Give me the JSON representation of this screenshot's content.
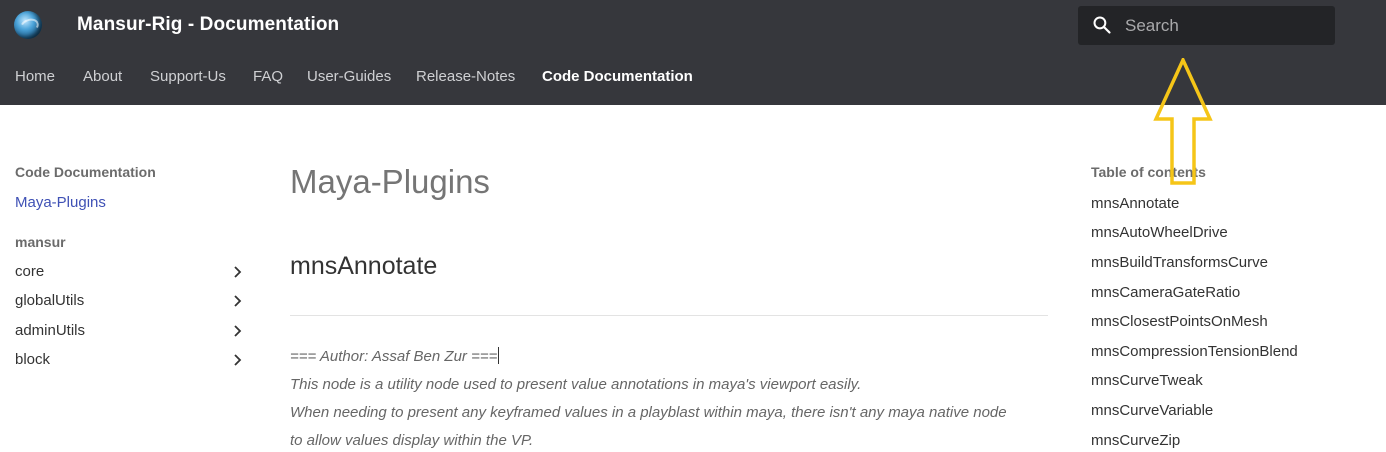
{
  "header": {
    "site_title": "Mansur-Rig - Documentation",
    "logo_icon": "globe-logo-icon",
    "search": {
      "placeholder": "Search",
      "value": "",
      "icon": "search-icon"
    }
  },
  "nav": {
    "items": [
      {
        "label": "Home"
      },
      {
        "label": "About"
      },
      {
        "label": "Support-Us"
      },
      {
        "label": "FAQ"
      },
      {
        "label": "User-Guides"
      },
      {
        "label": "Release-Notes"
      },
      {
        "label": "Code Documentation",
        "active": true
      }
    ]
  },
  "sidebar": {
    "section_heading": "Code Documentation",
    "active_link": "Maya-Plugins",
    "group_heading": "mansur",
    "items": [
      {
        "label": "core",
        "icon": "chevron-right-icon"
      },
      {
        "label": "globalUtils",
        "icon": "chevron-right-icon"
      },
      {
        "label": "adminUtils",
        "icon": "chevron-right-icon"
      },
      {
        "label": "block",
        "icon": "chevron-right-icon"
      }
    ]
  },
  "main": {
    "page_title": "Maya-Plugins",
    "section_title": "mnsAnnotate",
    "paragraphs": [
      "=== Author: Assaf Ben Zur ===",
      "This node is a utility node used to present value annotations in maya's viewport easily.",
      "When needing to present any keyframed values in a playblast within maya, there isn't any maya native node",
      "to allow values display within the VP."
    ]
  },
  "toc": {
    "heading": "Table of contents",
    "items": [
      "mnsAnnotate",
      "mnsAutoWheelDrive",
      "mnsBuildTransformsCurve",
      "mnsCameraGateRatio",
      "mnsClosestPointsOnMesh",
      "mnsCompressionTensionBlend",
      "mnsCurveTweak",
      "mnsCurveVariable",
      "mnsCurveZip"
    ]
  },
  "annotation": {
    "icon": "up-arrow-icon",
    "color": "#f5c518"
  },
  "colors": {
    "header_bg": "#36373c",
    "search_bg": "#232427",
    "link": "#3f51b5"
  }
}
